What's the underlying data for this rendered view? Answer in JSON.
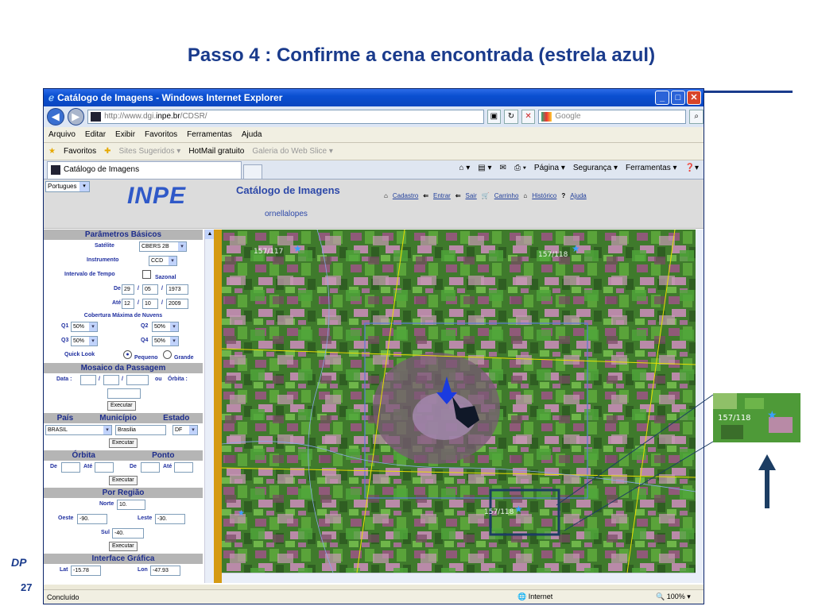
{
  "slide": {
    "title": "Passo 4 : Confirme a cena encontrada (estrela azul)",
    "page_number": "27",
    "logo_text": "DP"
  },
  "browser": {
    "window_title": "Catálogo de Imagens - Windows Internet Explorer",
    "address_prefix": "http://www.dgi.",
    "address_host": "inpe.br",
    "address_suffix": "/CDSR/",
    "search_placeholder": "Google",
    "menu": [
      "Arquivo",
      "Editar",
      "Exibir",
      "Favoritos",
      "Ferramentas",
      "Ajuda"
    ],
    "favorites_label": "Favoritos",
    "fav_links": [
      "Sites Sugeridos ▾",
      "HotMail gratuito",
      "Galeria do Web Slice ▾"
    ],
    "tab_label": "Catálogo de Imagens",
    "command_bar": [
      "Página ▾",
      "Segurança ▾",
      "Ferramentas ▾"
    ],
    "status_left": "Concluído",
    "status_zone": "Internet",
    "status_zoom": "100%"
  },
  "page": {
    "language": "Portugues",
    "logo": "INPE",
    "title": "Catálogo de Imagens",
    "user": "ornellalopes",
    "links": [
      "Cadastro",
      "Entrar",
      "Sair",
      "Carrinho",
      "Histórico",
      "Ajuda"
    ]
  },
  "panel": {
    "basic_title": "Parâmetros Básicos",
    "satellite_label": "Satélite",
    "satellite_value": "CBERS 2B",
    "instrument_label": "Instrumento",
    "instrument_value": "CCD",
    "interval_label": "Intervalo de Tempo",
    "seasonal_label": "Sazonal",
    "from_label": "De",
    "from_day": "29",
    "from_month": "05",
    "from_year": "1973",
    "to_label": "Até",
    "to_day": "12",
    "to_month": "10",
    "to_year": "2009",
    "cloud_title": "Cobertura Máxima de Nuvens",
    "q1_label": "Q1",
    "q1_value": "50%",
    "q2_label": "Q2",
    "q2_value": "50%",
    "q3_label": "Q3",
    "q3_value": "50%",
    "q4_label": "Q4",
    "q4_value": "50%",
    "quicklook_label": "Quick Look",
    "small_label": "Pequeno",
    "large_label": "Grande",
    "mosaic_title": "Mosaico da Passagem",
    "date_label": "Data :",
    "or_label": "ou",
    "orbit_label": "Órbita :",
    "execute": "Executar",
    "country_title": "País",
    "city_title": "Município",
    "state_title": "Estado",
    "country_value": "BRASIL",
    "city_value": "Brasilia",
    "state_value": "DF",
    "orbit_title": "Órbita",
    "point_title": "Ponto",
    "de_label": "De",
    "ate_label": "Até",
    "region_title": "Por Região",
    "north_label": "Norte",
    "north_value": "10.",
    "west_label": "Oeste",
    "west_value": "-90.",
    "east_label": "Leste",
    "east_value": "-30.",
    "south_label": "Sul",
    "south_value": "-40.",
    "graphic_title": "Interface Gráfica",
    "lat_label": "Lat",
    "lat_value": "-15.78",
    "lon_label": "Lon",
    "lon_value": "-47.93"
  },
  "map": {
    "scene_labels": [
      "157/117",
      "157/118",
      "157/118"
    ],
    "inset_label": "157/118"
  },
  "colors": {
    "title_blue": "#1a3b8c",
    "star_blue": "#3aa0ff",
    "marker_blue": "#1a3be0",
    "footprint_yellow": "#e8e000",
    "highlight_box": "#1c3d63"
  }
}
